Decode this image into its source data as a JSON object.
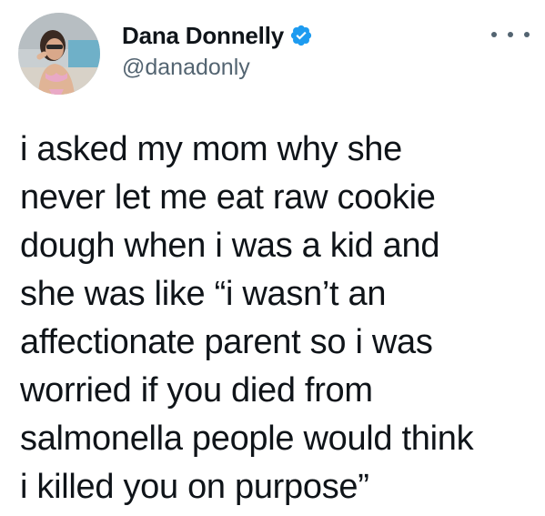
{
  "author": {
    "display_name": "Dana Donnelly",
    "handle": "@danadonly",
    "verified": true,
    "verified_color": "#1d9bf0"
  },
  "menu": {
    "icon": "more-horizontal-icon"
  },
  "tweet": {
    "lines": [
      "i asked my mom why she",
      "never let me eat raw cookie",
      "dough when i was a kid and",
      "she was like “i wasn’t an",
      "affectionate parent so i was",
      "worried if you died from",
      "salmonella people would think",
      "i killed you on purpose”"
    ]
  }
}
